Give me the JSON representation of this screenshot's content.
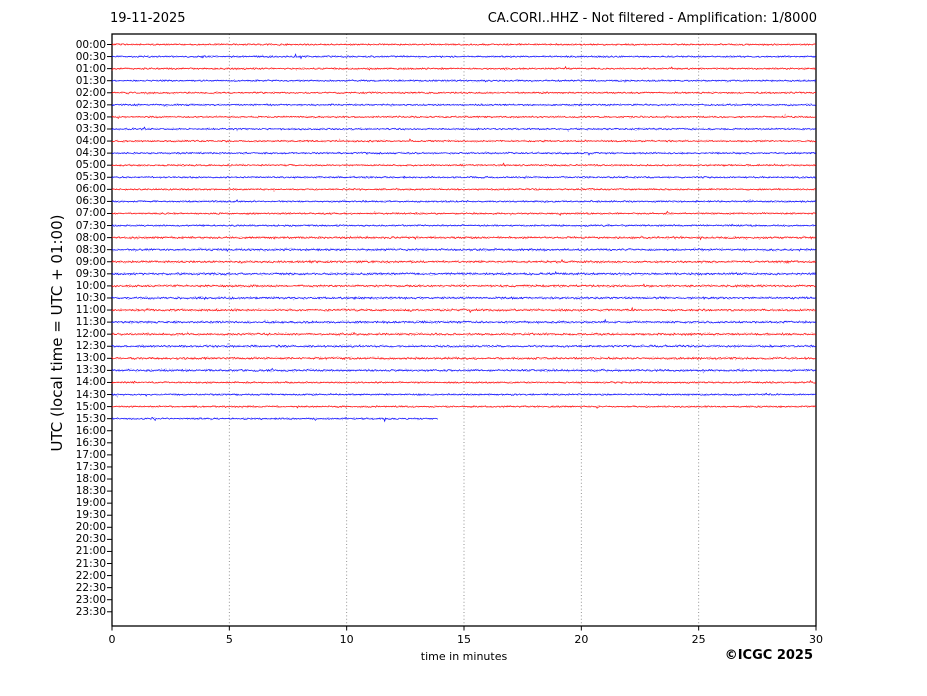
{
  "chart_data": {
    "type": "line",
    "subtype": "seismic-helicorder-day-plot",
    "date_label": "19-11-2025",
    "title": "CA.CORI..HHZ - Not filtered - Amplification: 1/8000",
    "station": "CA.CORI..HHZ",
    "filter": "Not filtered",
    "amplification": "1/8000",
    "xlabel": "time in minutes",
    "ylabel": "UTC (local time = UTC + 01:00)",
    "copyright": "©ICGC 2025",
    "x_range_minutes": [
      0,
      30
    ],
    "x_ticks": [
      0,
      5,
      10,
      15,
      20,
      25,
      30
    ],
    "grid": "vertical dotted lines at 5-minute intervals",
    "minutes_per_row": 30,
    "background": "#ffffff",
    "frame_color": "#000000",
    "grid_color": "#888888",
    "trace_colors": {
      "red": "#ff0000",
      "blue": "#0000ff"
    },
    "rows": [
      {
        "label": "00:00",
        "color": "red",
        "end_minute": 30
      },
      {
        "label": "00:30",
        "color": "blue",
        "end_minute": 30
      },
      {
        "label": "01:00",
        "color": "red",
        "end_minute": 30
      },
      {
        "label": "01:30",
        "color": "blue",
        "end_minute": 30
      },
      {
        "label": "02:00",
        "color": "red",
        "end_minute": 30
      },
      {
        "label": "02:30",
        "color": "blue",
        "end_minute": 30
      },
      {
        "label": "03:00",
        "color": "red",
        "end_minute": 30
      },
      {
        "label": "03:30",
        "color": "blue",
        "end_minute": 30
      },
      {
        "label": "04:00",
        "color": "red",
        "end_minute": 30
      },
      {
        "label": "04:30",
        "color": "blue",
        "end_minute": 30
      },
      {
        "label": "05:00",
        "color": "red",
        "end_minute": 30
      },
      {
        "label": "05:30",
        "color": "blue",
        "end_minute": 30
      },
      {
        "label": "06:00",
        "color": "red",
        "end_minute": 30
      },
      {
        "label": "06:30",
        "color": "blue",
        "end_minute": 30
      },
      {
        "label": "07:00",
        "color": "red",
        "end_minute": 30
      },
      {
        "label": "07:30",
        "color": "blue",
        "end_minute": 30
      },
      {
        "label": "08:00",
        "color": "red",
        "end_minute": 30
      },
      {
        "label": "08:30",
        "color": "blue",
        "end_minute": 30
      },
      {
        "label": "09:00",
        "color": "red",
        "end_minute": 30
      },
      {
        "label": "09:30",
        "color": "blue",
        "end_minute": 30
      },
      {
        "label": "10:00",
        "color": "red",
        "end_minute": 30
      },
      {
        "label": "10:30",
        "color": "blue",
        "end_minute": 30
      },
      {
        "label": "11:00",
        "color": "red",
        "end_minute": 30
      },
      {
        "label": "11:30",
        "color": "blue",
        "end_minute": 30
      },
      {
        "label": "12:00",
        "color": "red",
        "end_minute": 30
      },
      {
        "label": "12:30",
        "color": "blue",
        "end_minute": 30
      },
      {
        "label": "13:00",
        "color": "red",
        "end_minute": 30
      },
      {
        "label": "13:30",
        "color": "blue",
        "end_minute": 30
      },
      {
        "label": "14:00",
        "color": "red",
        "end_minute": 30
      },
      {
        "label": "14:30",
        "color": "blue",
        "end_minute": 30
      },
      {
        "label": "15:00",
        "color": "red",
        "end_minute": 30
      },
      {
        "label": "15:30",
        "color": "blue",
        "end_minute": 13.9
      },
      {
        "label": "16:00",
        "color": null,
        "end_minute": 0
      },
      {
        "label": "16:30",
        "color": null,
        "end_minute": 0
      },
      {
        "label": "17:00",
        "color": null,
        "end_minute": 0
      },
      {
        "label": "17:30",
        "color": null,
        "end_minute": 0
      },
      {
        "label": "18:00",
        "color": null,
        "end_minute": 0
      },
      {
        "label": "18:30",
        "color": null,
        "end_minute": 0
      },
      {
        "label": "19:00",
        "color": null,
        "end_minute": 0
      },
      {
        "label": "19:30",
        "color": null,
        "end_minute": 0
      },
      {
        "label": "20:00",
        "color": null,
        "end_minute": 0
      },
      {
        "label": "20:30",
        "color": null,
        "end_minute": 0
      },
      {
        "label": "21:00",
        "color": null,
        "end_minute": 0
      },
      {
        "label": "21:30",
        "color": null,
        "end_minute": 0
      },
      {
        "label": "22:00",
        "color": null,
        "end_minute": 0
      },
      {
        "label": "22:30",
        "color": null,
        "end_minute": 0
      },
      {
        "label": "23:00",
        "color": null,
        "end_minute": 0
      },
      {
        "label": "23:30",
        "color": null,
        "end_minute": 0
      }
    ]
  }
}
